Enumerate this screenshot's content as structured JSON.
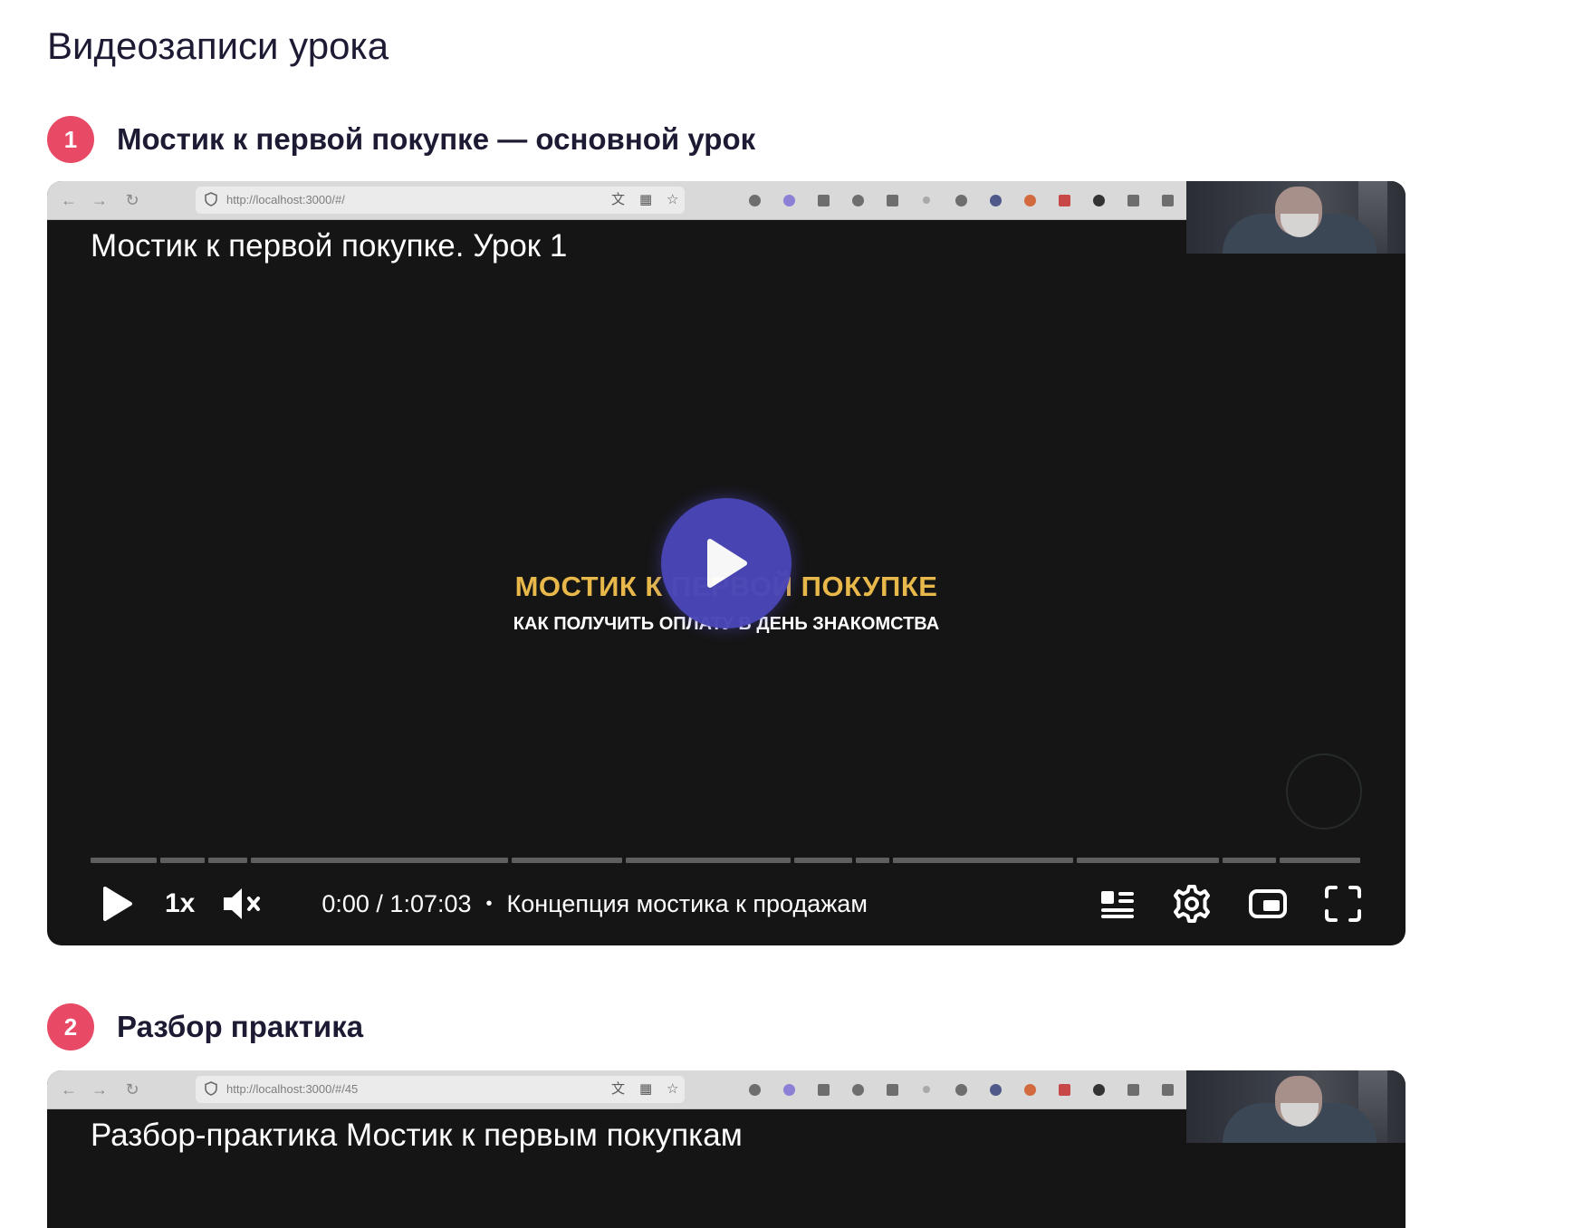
{
  "page": {
    "title": "Видеозаписи урока"
  },
  "colors": {
    "badge": "#e84a66",
    "play_button": "#4a46b8",
    "slide_accent": "#e8b94a"
  },
  "lessons": [
    {
      "number": "1",
      "title": "Мостик к первой покупке — основной урок",
      "browser_url": "http://localhost:3000/#/",
      "video_title": "Мостик к первой покупке. Урок 1",
      "slide_title": "МОСТИК К ПЕРВОЙ ПОКУПКЕ",
      "slide_subtitle": "КАК ПОЛУЧИТЬ ОПЛАТУ В ДЕНЬ ЗНАКОМСТВА",
      "player": {
        "speed_label": "1x",
        "time": "0:00 / 1:07:03",
        "separator": "•",
        "chapter": "Концепция мостика к продажам",
        "progress": 0,
        "icons": [
          "play-icon",
          "mute-icon",
          "chapters-icon",
          "settings-icon",
          "miniplayer-icon",
          "fullscreen-icon"
        ]
      }
    },
    {
      "number": "2",
      "title": "Разбор практика",
      "browser_url": "http://localhost:3000/#/45",
      "video_title": "Разбор-практика Мостик к первым покупкам"
    }
  ]
}
